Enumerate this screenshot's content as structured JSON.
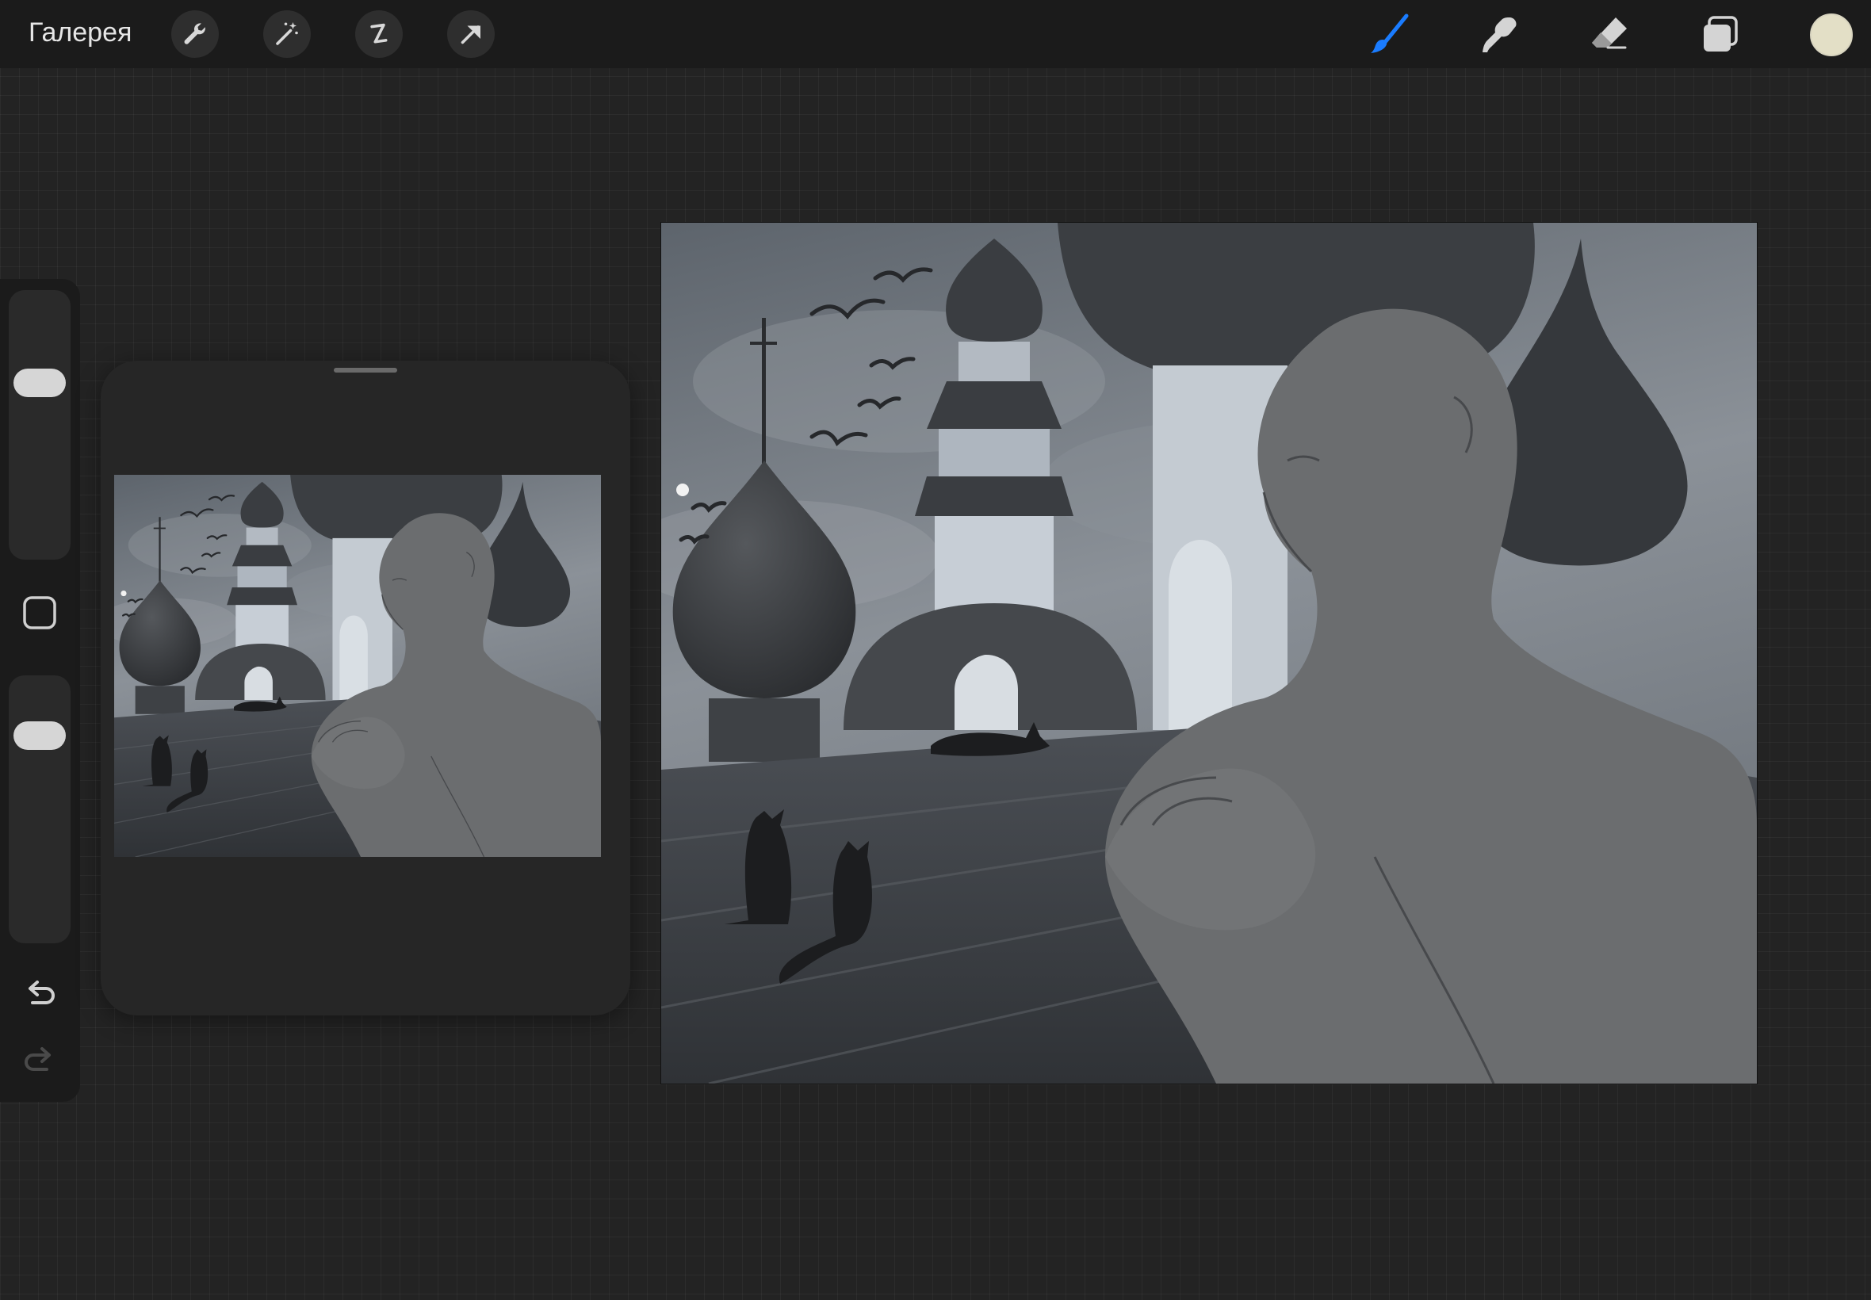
{
  "topbar": {
    "gallery_label": "Галерея",
    "left_tools": [
      {
        "name": "wrench-icon",
        "action": "actions"
      },
      {
        "name": "magic-wand-icon",
        "action": "adjustments"
      },
      {
        "name": "selection-icon",
        "action": "selection"
      },
      {
        "name": "transform-arrow-icon",
        "action": "transform"
      }
    ],
    "right_tools": [
      {
        "name": "brush-icon",
        "active": true
      },
      {
        "name": "smudge-icon",
        "active": false
      },
      {
        "name": "eraser-icon",
        "active": false
      },
      {
        "name": "layers-icon",
        "active": false
      }
    ],
    "current_color": "#e3dfc6",
    "active_tool_color": "#1a7cff"
  },
  "sidebar": {
    "brush_size_level": 0.68,
    "opacity_level": 0.82,
    "modify_button": "square-modify-icon",
    "undo": "undo-icon",
    "redo": "redo-icon"
  },
  "reference_panel": {
    "content": "reference-image-thumbnail"
  },
  "canvas": {
    "content": "artwork-monk-with-cats-and-domes"
  }
}
